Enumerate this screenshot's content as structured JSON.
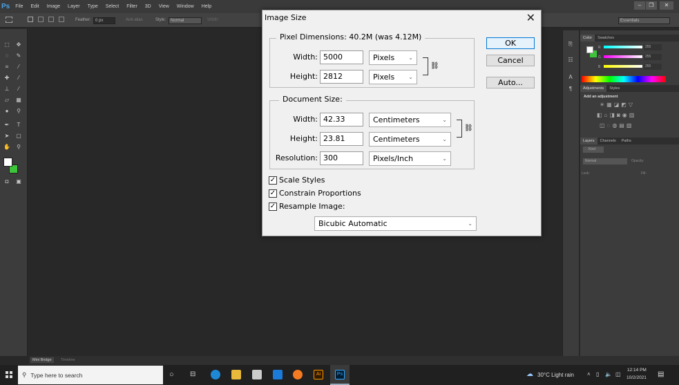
{
  "app": {
    "logo": "Ps",
    "menu": [
      "File",
      "Edit",
      "Image",
      "Layer",
      "Type",
      "Select",
      "Filter",
      "3D",
      "View",
      "Window",
      "Help"
    ]
  },
  "options": {
    "feather_label": "Feather:",
    "feather_value": "0 px",
    "anti_alias": "Anti-alias",
    "style_label": "Style:",
    "style_value": "Normal",
    "width_label": "Width:",
    "workspace": "Essentials"
  },
  "panels": {
    "color_tabs": [
      "Color",
      "Swatches"
    ],
    "rgb_values": [
      "255",
      "255",
      "255"
    ],
    "rgb_labels": [
      "R",
      "G",
      "B"
    ],
    "adj_tabs": [
      "Adjustments",
      "Styles"
    ],
    "adj_title": "Add an adjustment",
    "layer_tabs": [
      "Layers",
      "Channels",
      "Paths"
    ],
    "kind": "Kind",
    "blend": "Normal",
    "opacity_label": "Opacity:",
    "lock_label": "Lock:",
    "fill_label": "Fill:"
  },
  "bottom_tabs": [
    "Mini Bridge",
    "Timeline"
  ],
  "colors": {
    "foreground": "#ffffff",
    "background": "#3ec43a",
    "accent": "#0078d7"
  },
  "dialog": {
    "title": "Image Size",
    "pixel_dimensions": "Pixel Dimensions:  40.2M (was 4.12M)",
    "px_width_label": "Width:",
    "px_width": "5000",
    "px_width_unit": "Pixels",
    "px_height_label": "Height:",
    "px_height": "2812",
    "px_height_unit": "Pixels",
    "document_size": "Document Size:",
    "doc_width_label": "Width:",
    "doc_width": "42.33",
    "doc_width_unit": "Centimeters",
    "doc_height_label": "Height:",
    "doc_height": "23.81",
    "doc_height_unit": "Centimeters",
    "resolution_label": "Resolution:",
    "resolution": "300",
    "resolution_unit": "Pixels/Inch",
    "scale_styles": "Scale Styles",
    "constrain": "Constrain Proportions",
    "resample": "Resample Image:",
    "resample_method": "Bicubic Automatic",
    "ok": "OK",
    "cancel": "Cancel",
    "auto": "Auto..."
  },
  "taskbar": {
    "search_placeholder": "Type here to search",
    "weather": "30°C  Light rain",
    "time": "12:14 PM",
    "date": "10/2/2021"
  }
}
